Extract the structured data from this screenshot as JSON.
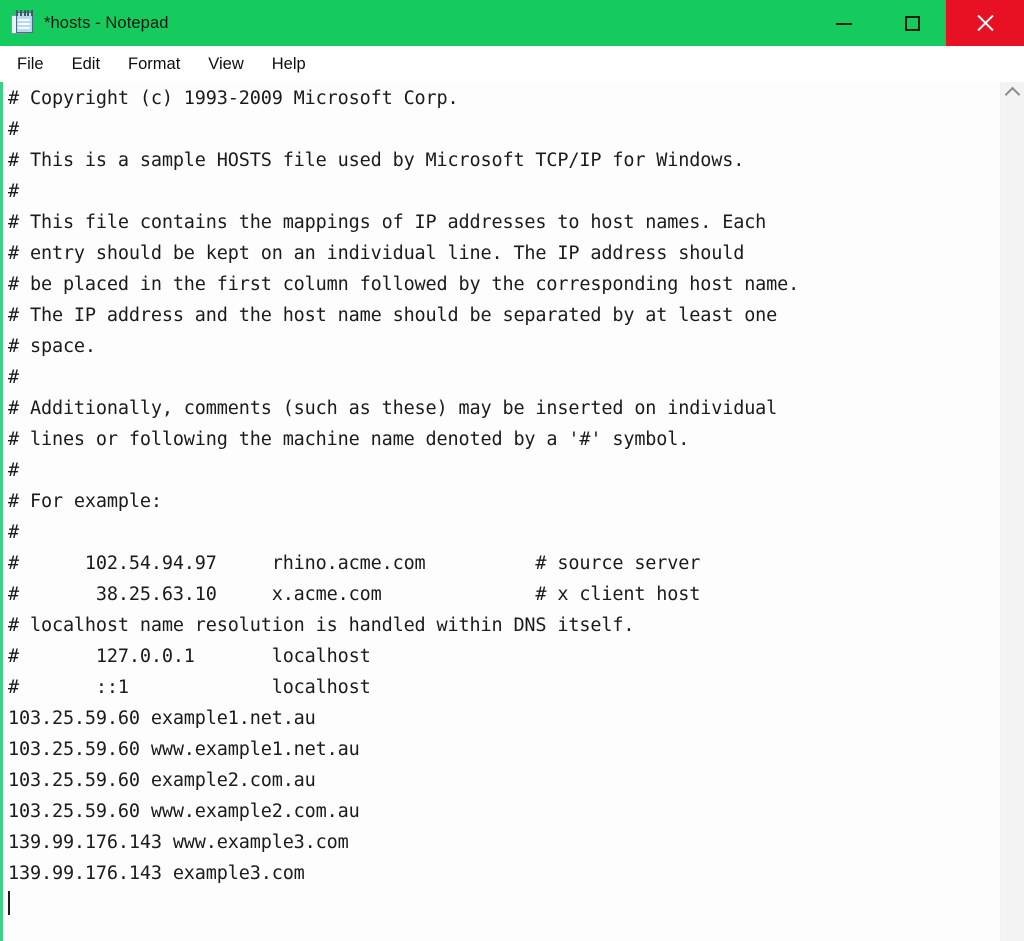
{
  "window": {
    "title": "*hosts - Notepad",
    "app_icon": "notepad-icon",
    "accent_color": "#15cb5d",
    "close_color": "#e71123",
    "left_edge_color": "#3ecf86",
    "editor_background": "#fdfdfd"
  },
  "controls": {
    "minimize_label": "Minimize",
    "maximize_label": "Maximize",
    "close_label": "Close"
  },
  "menu": {
    "items": [
      {
        "label": "File"
      },
      {
        "label": "Edit"
      },
      {
        "label": "Format"
      },
      {
        "label": "View"
      },
      {
        "label": "Help"
      }
    ]
  },
  "editor": {
    "lines": [
      "# Copyright (c) 1993-2009 Microsoft Corp.",
      "#",
      "# This is a sample HOSTS file used by Microsoft TCP/IP for Windows.",
      "#",
      "# This file contains the mappings of IP addresses to host names. Each",
      "# entry should be kept on an individual line. The IP address should",
      "# be placed in the first column followed by the corresponding host name.",
      "# The IP address and the host name should be separated by at least one",
      "# space.",
      "#",
      "# Additionally, comments (such as these) may be inserted on individual",
      "# lines or following the machine name denoted by a '#' symbol.",
      "#",
      "# For example:",
      "#",
      "#      102.54.94.97     rhino.acme.com          # source server",
      "#       38.25.63.10     x.acme.com              # x client host",
      "# localhost name resolution is handled within DNS itself.",
      "#       127.0.0.1       localhost",
      "#       ::1             localhost",
      "103.25.59.60 example1.net.au",
      "103.25.59.60 www.example1.net.au",
      "103.25.59.60 example2.com.au",
      "103.25.59.60 www.example2.com.au",
      "139.99.176.143 www.example3.com",
      "139.99.176.143 example3.com"
    ],
    "caret_on_last_line": true
  },
  "scrollbar": {
    "up_arrow_icon": "chevron-up-icon",
    "orientation": "vertical",
    "position": "top"
  }
}
